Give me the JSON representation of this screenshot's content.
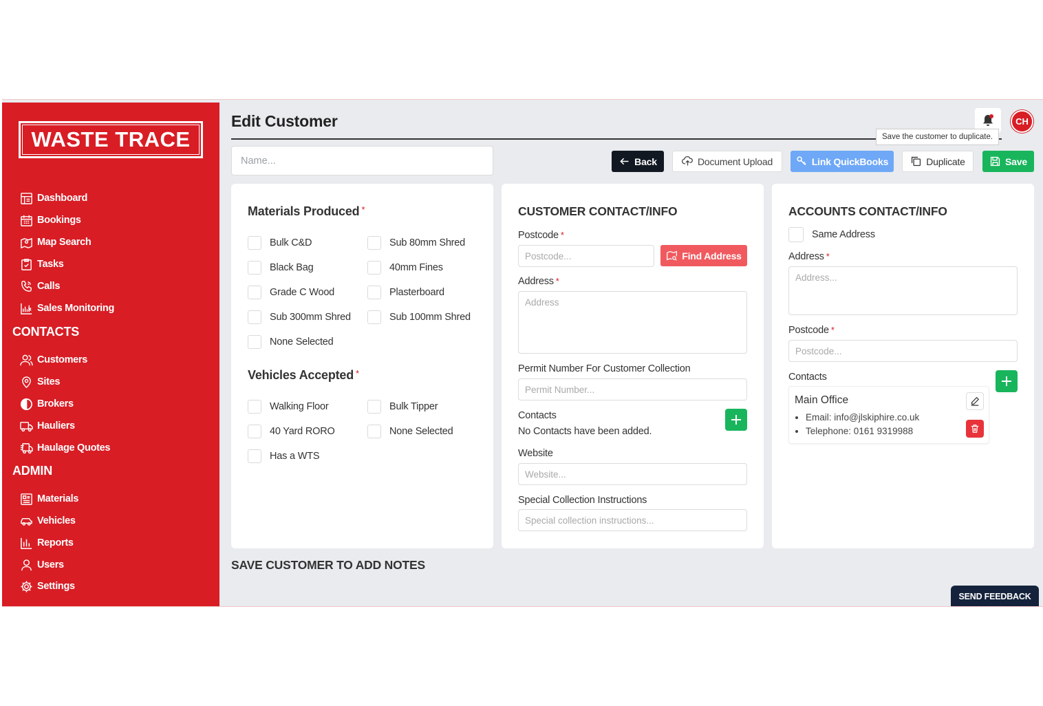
{
  "brand": {
    "logo_text": "WASTE TRACE",
    "accent": "#d81d25"
  },
  "sidebar": {
    "main_items": [
      {
        "label": "Dashboard",
        "icon": "dashboard-icon"
      },
      {
        "label": "Bookings",
        "icon": "calendar-icon"
      },
      {
        "label": "Map Search",
        "icon": "map-icon"
      },
      {
        "label": "Tasks",
        "icon": "clipboard-check-icon"
      },
      {
        "label": "Calls",
        "icon": "phone-icon"
      },
      {
        "label": "Sales Monitoring",
        "icon": "sales-chart-icon"
      }
    ],
    "contacts_heading": "CONTACTS",
    "contacts_items": [
      {
        "label": "Customers",
        "icon": "users-icon"
      },
      {
        "label": "Sites",
        "icon": "map-pin-icon"
      },
      {
        "label": "Brokers",
        "icon": "broker-icon"
      },
      {
        "label": "Hauliers",
        "icon": "truck-icon"
      },
      {
        "label": "Haulage Quotes",
        "icon": "quote-truck-icon"
      }
    ],
    "admin_heading": "ADMIN",
    "admin_items": [
      {
        "label": "Materials",
        "icon": "materials-icon"
      },
      {
        "label": "Vehicles",
        "icon": "car-icon"
      },
      {
        "label": "Reports",
        "icon": "bar-chart-icon"
      },
      {
        "label": "Users",
        "icon": "user-icon"
      },
      {
        "label": "Settings",
        "icon": "gear-icon"
      }
    ]
  },
  "header": {
    "title": "Edit Customer",
    "avatar_initials": "CH",
    "tooltip": "Save the customer to duplicate.",
    "name_placeholder": "Name..."
  },
  "toolbar": {
    "back": "Back",
    "document_upload": "Document Upload",
    "link_quickbooks": "Link QuickBooks",
    "duplicate": "Duplicate",
    "save": "Save"
  },
  "materials_card": {
    "title": "Materials Produced",
    "required_mark": "*",
    "materials": [
      [
        "Bulk C&D",
        "Sub 80mm Shred"
      ],
      [
        "Black Bag",
        "40mm Fines"
      ],
      [
        "Grade C Wood",
        "Plasterboard"
      ],
      [
        "Sub 300mm Shred",
        "Sub 100mm Shred"
      ],
      [
        "None Selected"
      ]
    ],
    "vehicles_title": "Vehicles Accepted",
    "vehicles": [
      [
        "Walking Floor",
        "Bulk Tipper"
      ],
      [
        "40 Yard RORO",
        "None Selected"
      ],
      [
        "Has a WTS"
      ]
    ]
  },
  "customer_card": {
    "title": "CUSTOMER CONTACT/INFO",
    "postcode_label": "Postcode",
    "postcode_placeholder": "Postcode...",
    "find_address": "Find Address",
    "address_label": "Address",
    "address_placeholder": "Address",
    "permit_label": "Permit Number For Customer Collection",
    "permit_placeholder": "Permit Number...",
    "contacts_label": "Contacts",
    "contacts_empty": "No Contacts have been added.",
    "website_label": "Website",
    "website_placeholder": "Website...",
    "special_label": "Special Collection Instructions",
    "special_placeholder": "Special collection instructions..."
  },
  "accounts_card": {
    "title": "ACCOUNTS CONTACT/INFO",
    "same_address": "Same Address",
    "address_label": "Address",
    "address_placeholder": "Address...",
    "postcode_label": "Postcode",
    "postcode_placeholder": "Postcode...",
    "contacts_label": "Contacts",
    "contact": {
      "name": "Main Office",
      "email": "Email: info@jlskiphire.co.uk",
      "telephone": "Telephone: 0161 9319988"
    }
  },
  "notes_heading": "SAVE CUSTOMER TO ADD NOTES",
  "feedback_button": "SEND FEEDBACK"
}
